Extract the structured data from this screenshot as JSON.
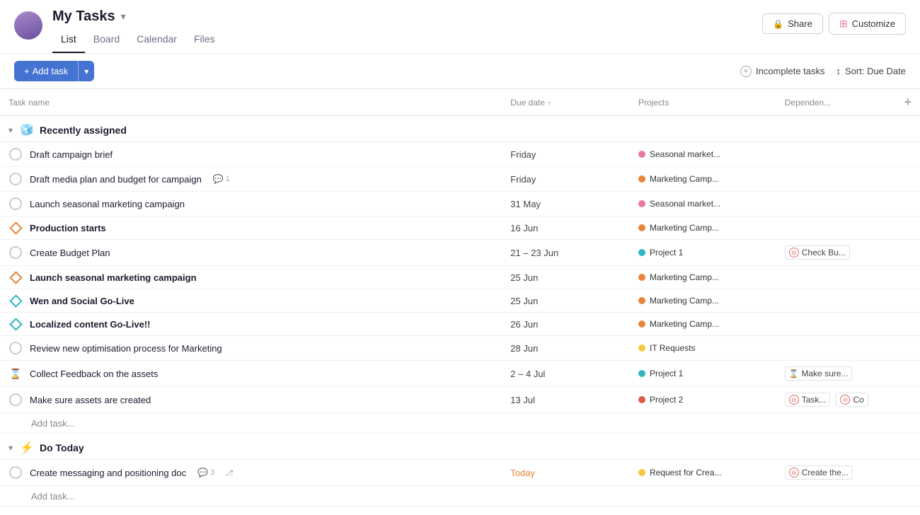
{
  "header": {
    "title": "My Tasks",
    "tabs": [
      {
        "label": "List",
        "active": true
      },
      {
        "label": "Board",
        "active": false
      },
      {
        "label": "Calendar",
        "active": false
      },
      {
        "label": "Files",
        "active": false
      }
    ],
    "share_label": "Share",
    "customize_label": "Customize"
  },
  "toolbar": {
    "add_task_label": "+ Add task",
    "filter_label": "Incomplete tasks",
    "sort_label": "Sort: Due Date"
  },
  "table": {
    "columns": [
      {
        "key": "name",
        "label": "Task name"
      },
      {
        "key": "due",
        "label": "Due date"
      },
      {
        "key": "projects",
        "label": "Projects"
      },
      {
        "key": "depends",
        "label": "Dependen..."
      }
    ]
  },
  "sections": [
    {
      "id": "recently-assigned",
      "emoji": "🧊",
      "label": "Recently assigned",
      "collapsed": false,
      "tasks": [
        {
          "id": 1,
          "icon_type": "circle",
          "name": "Draft campaign brief",
          "milestone": false,
          "due": "Friday",
          "due_highlight": false,
          "project": "Seasonal market...",
          "project_color": "dot-pink",
          "depends": ""
        },
        {
          "id": 2,
          "icon_type": "circle",
          "name": "Draft media plan and budget for campaign",
          "milestone": false,
          "comment_count": "1",
          "due": "Friday",
          "due_highlight": false,
          "project": "Marketing Camp...",
          "project_color": "dot-orange",
          "depends": ""
        },
        {
          "id": 3,
          "icon_type": "circle",
          "name": "Launch seasonal marketing campaign",
          "milestone": false,
          "due": "31 May",
          "due_highlight": false,
          "project": "Seasonal market...",
          "project_color": "dot-pink",
          "depends": ""
        },
        {
          "id": 4,
          "icon_type": "diamond-orange",
          "name": "Production starts",
          "milestone": true,
          "due": "16 Jun",
          "due_highlight": false,
          "project": "Marketing Camp...",
          "project_color": "dot-orange",
          "depends": ""
        },
        {
          "id": 5,
          "icon_type": "circle",
          "name": "Create Budget Plan",
          "milestone": false,
          "due": "21 – 23 Jun",
          "due_highlight": false,
          "project": "Project 1",
          "project_color": "dot-teal",
          "depends": "Check Bu...",
          "depends_icon": "blocked"
        },
        {
          "id": 6,
          "icon_type": "diamond-orange",
          "name": "Launch seasonal marketing campaign",
          "milestone": true,
          "due": "25 Jun",
          "due_highlight": false,
          "project": "Marketing Camp...",
          "project_color": "dot-orange",
          "depends": ""
        },
        {
          "id": 7,
          "icon_type": "diamond-teal",
          "name": "Wen and Social Go-Live",
          "milestone": true,
          "due": "25 Jun",
          "due_highlight": false,
          "project": "Marketing Camp...",
          "project_color": "dot-orange",
          "depends": ""
        },
        {
          "id": 8,
          "icon_type": "diamond-teal",
          "name": "Localized content Go-Live!!",
          "milestone": true,
          "due": "26 Jun",
          "due_highlight": false,
          "project": "Marketing Camp...",
          "project_color": "dot-orange",
          "depends": ""
        },
        {
          "id": 9,
          "icon_type": "circle",
          "name": "Review new optimisation process for Marketing",
          "milestone": false,
          "due": "28 Jun",
          "due_highlight": false,
          "project": "IT Requests",
          "project_color": "dot-yellow",
          "depends": ""
        },
        {
          "id": 10,
          "icon_type": "hourglass",
          "name": "Collect Feedback on the assets",
          "milestone": false,
          "due": "2 – 4 Jul",
          "due_highlight": false,
          "project": "Project 1",
          "project_color": "dot-teal",
          "depends": "Make sure...",
          "depends_icon": "hourglass"
        },
        {
          "id": 11,
          "icon_type": "circle",
          "name": "Make sure assets are created",
          "milestone": false,
          "due": "13 Jul",
          "due_highlight": false,
          "project": "Project 2",
          "project_color": "dot-red",
          "depends": "Task...",
          "depends_icon": "blocked",
          "depends2": "Co",
          "depends2_icon": "blocked"
        }
      ],
      "add_task_label": "Add task..."
    },
    {
      "id": "do-today",
      "emoji": "⚡",
      "label": "Do Today",
      "collapsed": false,
      "tasks": [
        {
          "id": 12,
          "icon_type": "circle",
          "name": "Create messaging and positioning doc",
          "milestone": false,
          "comment_count": "3",
          "has_subtasks": true,
          "due": "Today",
          "due_highlight": true,
          "project": "Request for Crea...",
          "project_color": "dot-yellow",
          "depends": "Create the...",
          "depends_icon": "blocked"
        }
      ],
      "add_task_label": "Add task..."
    }
  ]
}
